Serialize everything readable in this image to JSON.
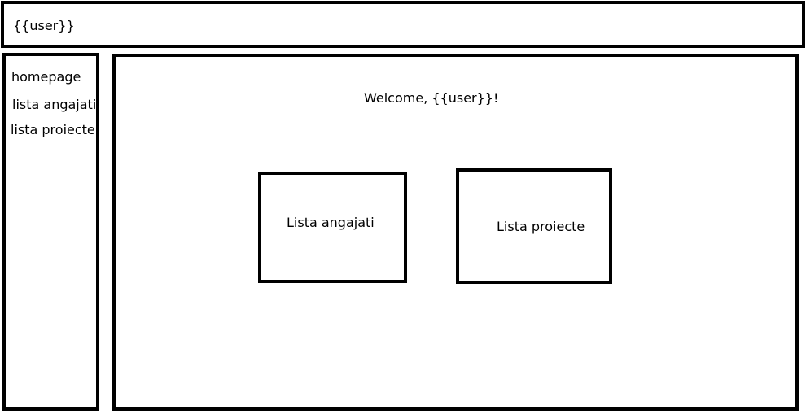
{
  "header": {
    "user": "{{user}}"
  },
  "sidebar": {
    "items": [
      {
        "label": "homepage"
      },
      {
        "label": "lista angajati"
      },
      {
        "label": "lista proiecte"
      }
    ]
  },
  "main": {
    "welcome": "Welcome, {{user}}!",
    "cards": [
      {
        "label": "Lista angajati"
      },
      {
        "label": "Lista proiecte"
      }
    ]
  }
}
